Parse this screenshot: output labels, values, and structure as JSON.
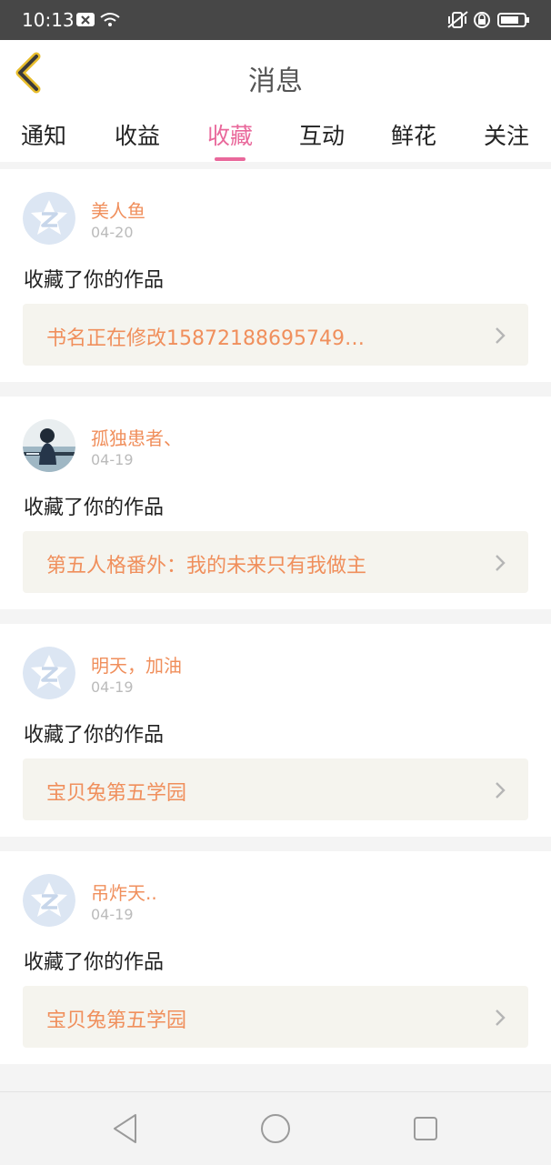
{
  "status_bar": {
    "time": "10:13"
  },
  "header": {
    "title": "消息"
  },
  "tabs": [
    {
      "label": "通知"
    },
    {
      "label": "收益"
    },
    {
      "label": "收藏",
      "active": true
    },
    {
      "label": "互动"
    },
    {
      "label": "鲜花"
    },
    {
      "label": "关注"
    }
  ],
  "messages": [
    {
      "user": "美人鱼",
      "date": "04-20",
      "action": "收藏了你的作品",
      "book": "书名正在修改15872188695749…"
    },
    {
      "user": "孤独患者、",
      "date": "04-19",
      "action": "收藏了你的作品",
      "book": "第五人格番外：我的未来只有我做主"
    },
    {
      "user": "明天，加油",
      "date": "04-19",
      "action": "收藏了你的作品",
      "book": "宝贝兔第五学园"
    },
    {
      "user": "吊炸天..",
      "date": "04-19",
      "action": "收藏了你的作品",
      "book": "宝贝兔第五学园"
    }
  ],
  "colors": {
    "accent": "#e9689b",
    "username": "#f08f5c",
    "book_bg": "#f5f4ee",
    "status_bar": "#474747"
  }
}
